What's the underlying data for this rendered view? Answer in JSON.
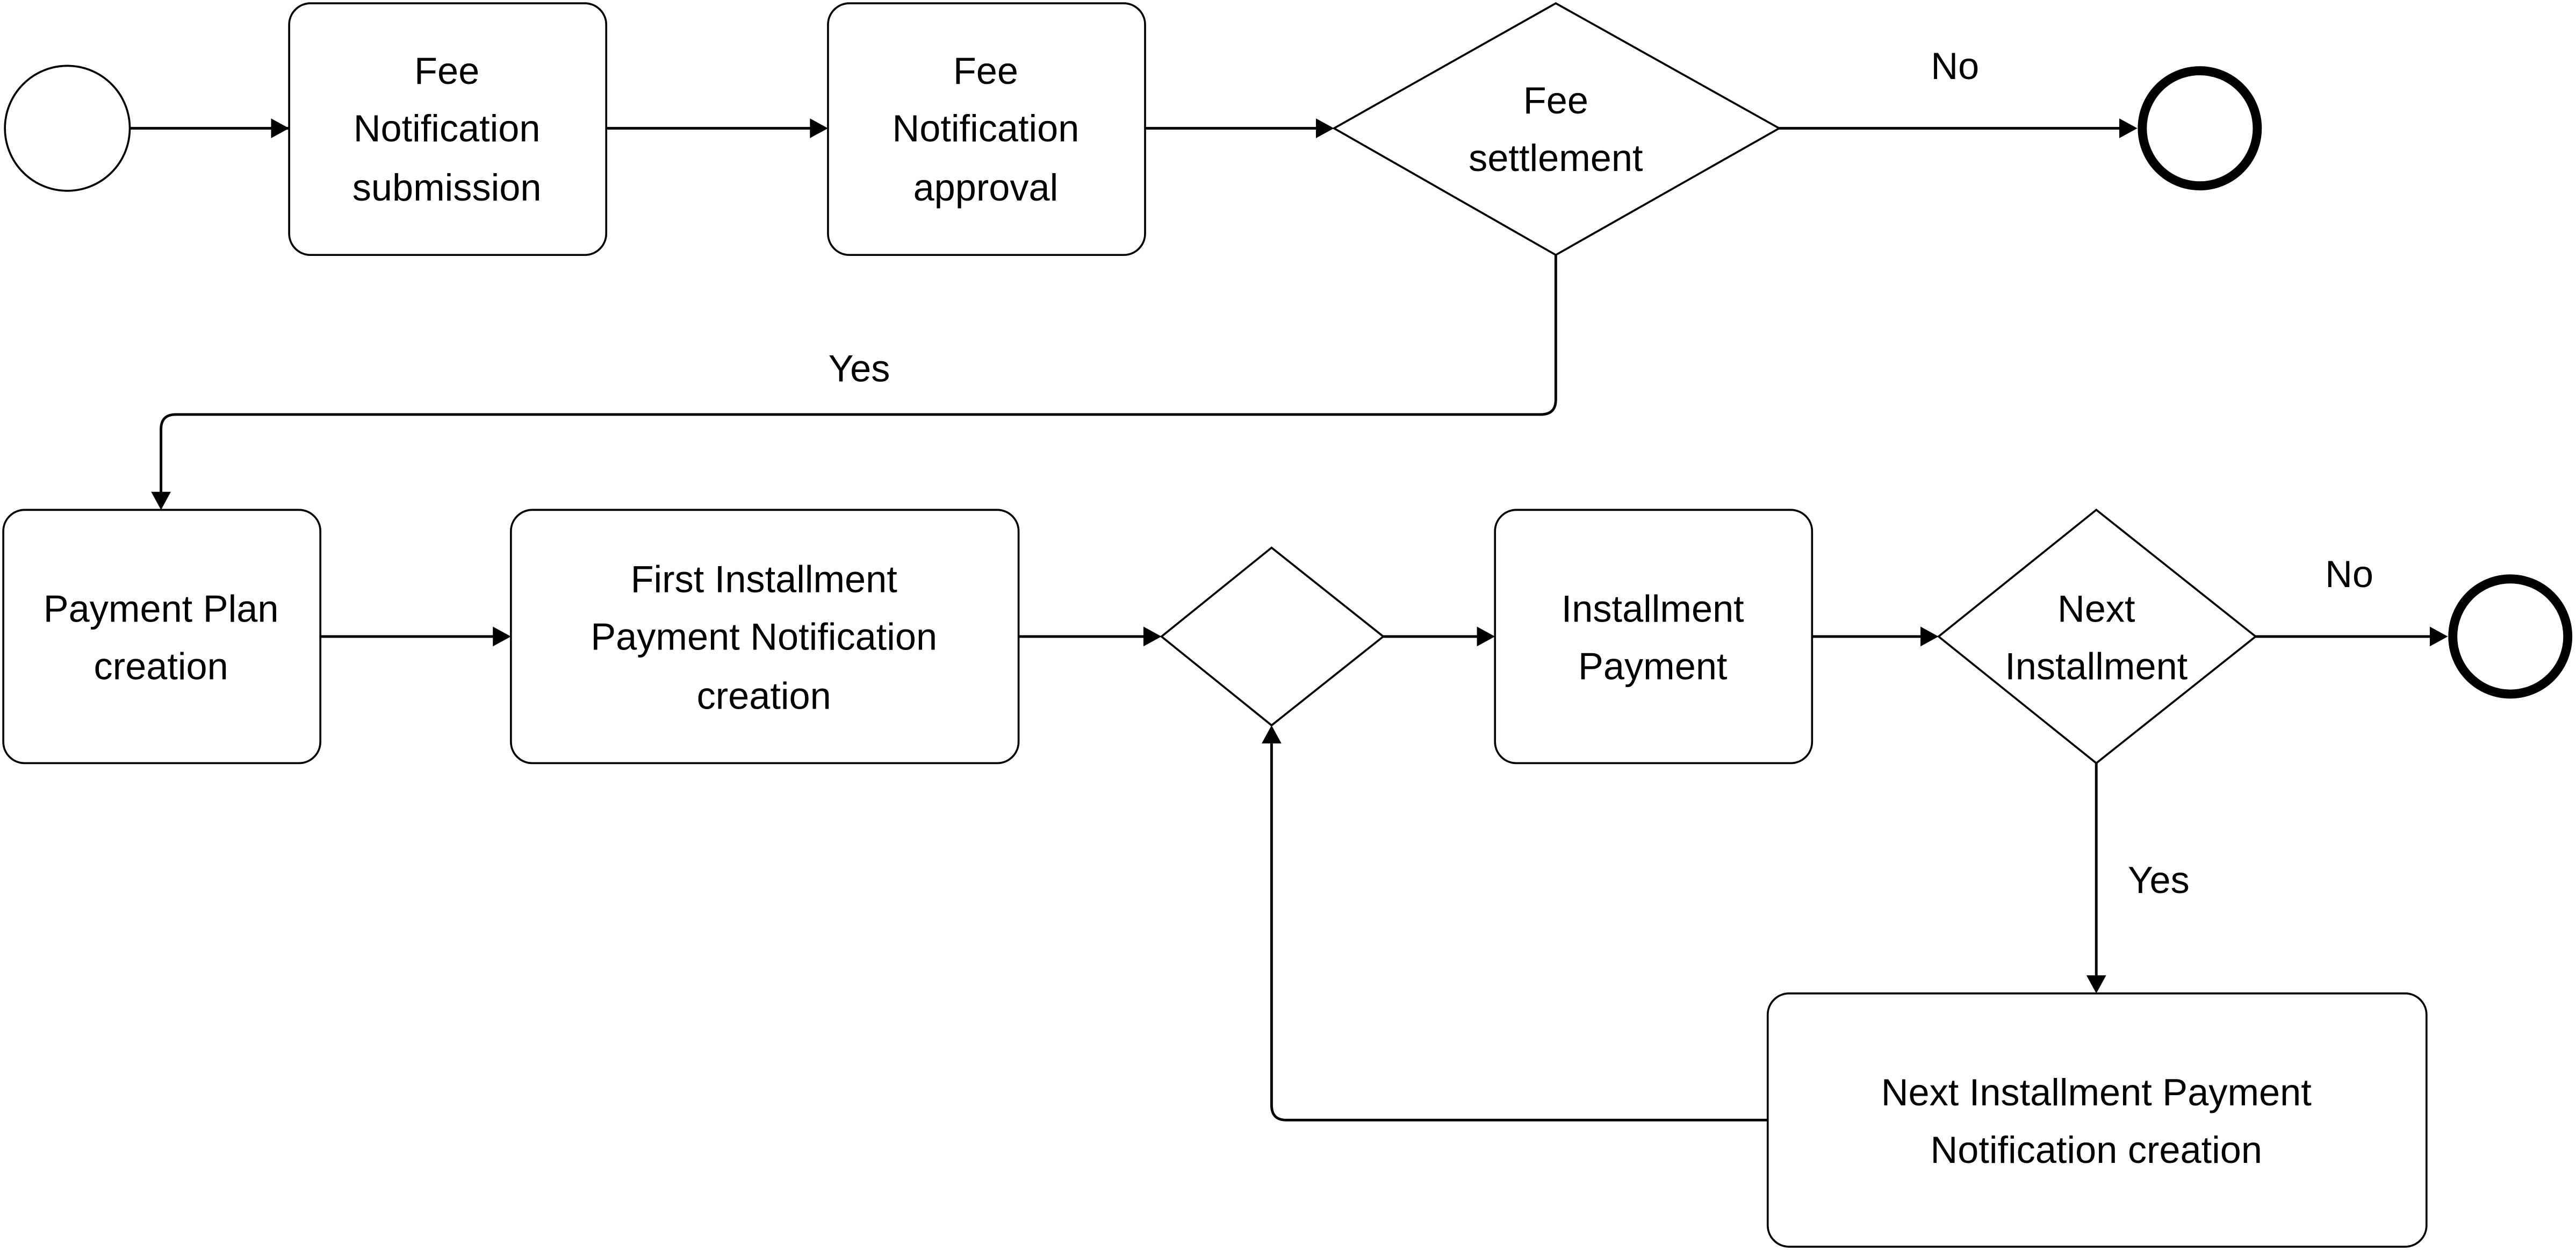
{
  "diagram": {
    "type": "BPMN process flow",
    "nodes": {
      "start": {
        "kind": "start-event"
      },
      "fee_submission": {
        "kind": "task",
        "lines": [
          "Fee",
          "Notification",
          "submission"
        ]
      },
      "fee_approval": {
        "kind": "task",
        "lines": [
          "Fee",
          "Notification",
          "approval"
        ]
      },
      "fee_settlement": {
        "kind": "gateway",
        "lines": [
          "Fee",
          "settlement"
        ]
      },
      "end_top": {
        "kind": "end-event"
      },
      "payment_plan": {
        "kind": "task",
        "lines": [
          "Payment Plan",
          "creation"
        ]
      },
      "first_installment": {
        "kind": "task",
        "lines": [
          "First Installment",
          "Payment Notification",
          "creation"
        ]
      },
      "merge_gateway": {
        "kind": "gateway",
        "lines": []
      },
      "installment_payment": {
        "kind": "task",
        "lines": [
          "Installment",
          "Payment"
        ]
      },
      "next_installment": {
        "kind": "gateway",
        "lines": [
          "Next",
          "Installment"
        ]
      },
      "end_bottom": {
        "kind": "end-event"
      },
      "next_installment_notification": {
        "kind": "task",
        "lines": [
          "Next Installment Payment",
          "Notification creation"
        ]
      }
    },
    "edges": [
      {
        "from": "start",
        "to": "fee_submission",
        "label": ""
      },
      {
        "from": "fee_submission",
        "to": "fee_approval",
        "label": ""
      },
      {
        "from": "fee_approval",
        "to": "fee_settlement",
        "label": ""
      },
      {
        "from": "fee_settlement",
        "to": "end_top",
        "label": "No"
      },
      {
        "from": "fee_settlement",
        "to": "payment_plan",
        "label": "Yes"
      },
      {
        "from": "payment_plan",
        "to": "first_installment",
        "label": ""
      },
      {
        "from": "first_installment",
        "to": "merge_gateway",
        "label": ""
      },
      {
        "from": "merge_gateway",
        "to": "installment_payment",
        "label": ""
      },
      {
        "from": "installment_payment",
        "to": "next_installment",
        "label": ""
      },
      {
        "from": "next_installment",
        "to": "end_bottom",
        "label": "No"
      },
      {
        "from": "next_installment",
        "to": "next_installment_notification",
        "label": "Yes"
      },
      {
        "from": "next_installment_notification",
        "to": "merge_gateway",
        "label": ""
      }
    ],
    "labels": {
      "settlement_no": "No",
      "settlement_yes": "Yes",
      "next_no": "No",
      "next_yes": "Yes"
    }
  }
}
